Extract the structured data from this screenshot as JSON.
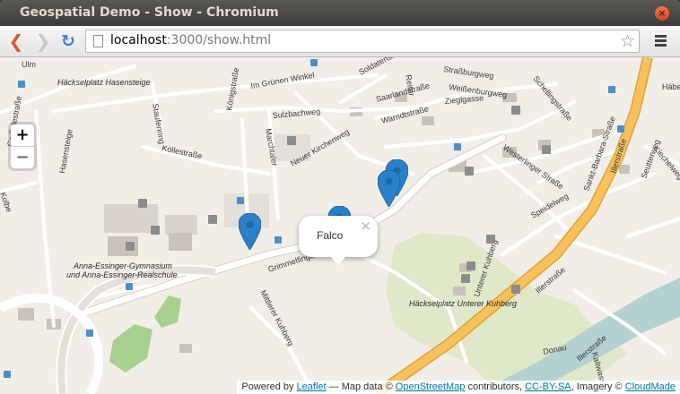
{
  "window": {
    "title": "Geospatial Demo - Show - Chromium",
    "close_glyph": "×"
  },
  "toolbar": {
    "back_glyph": "❮",
    "forward_glyph": "❯",
    "reload_glyph": "↻",
    "url_host": "localhost",
    "url_rest": ":3000/show.html",
    "star_glyph": "☆"
  },
  "map": {
    "zoom_in_label": "+",
    "zoom_out_label": "−",
    "popup": {
      "text": "Falco",
      "close_glyph": "×"
    },
    "marker_color": "#2981ca",
    "labels": {
      "ulm": "Ulm",
      "hasenst": "Häckselplatz Hasensteige",
      "gruenen": "Im Grünen Winkel",
      "koenig": "Königstraße",
      "sulzbach": "Sulzbachweg",
      "neuer": "Neuer Kirchenweg",
      "kolle": "Köllestraße",
      "staufen": "Staufenring",
      "marchtaler": "Marchtaler",
      "soldaten": "Soldatenstraße",
      "strassburg": "Straßburgweg",
      "weissenburg": "Weißenburgweg",
      "zieglgasse": "Zieglgasse",
      "saarland": "Saarlandstraße",
      "warndt": "Warndtstraße",
      "schelling": "Schellingstraße",
      "westerlinger": "Westerlinger Straße",
      "speidel": "Speidelweg",
      "sankt": "Sankt-Barbara-Straße",
      "iller1": "Illerstraße",
      "iller2": "Illerstraße",
      "iller3": "Illerstraße",
      "gymn1": "Anna-Essinger-Gymnasium",
      "gymn2": "und Anna-Essinger-Realschule",
      "grimmel": "Grimmelfinger Weg",
      "mittlerer": "Mittlerer Kuhberg",
      "unterer": "Unterer Kuhberg",
      "hackunt": "Häckselplatz Unterer Kuhberg",
      "donau": "Donau",
      "geissel": "Geißelestraße",
      "hasensteige": "Hasensteige",
      "kiechel": "Kiechelweg",
      "seutter": "Seutterweg",
      "kaltwasser": "Kaltwasser",
      "reiter": "Reiter",
      "haeb": "Häbe",
      "kolle2": "Kolbe"
    }
  },
  "attribution": {
    "prefix": "Powered by",
    "leaflet": "Leaflet",
    "mapdata": " — Map data © ",
    "osm": "OpenStreetMap",
    "contributors": " contributors, ",
    "ccbysa": "CC-BY-SA",
    "imagery": ", Imagery © ",
    "cloudmade": "CloudMade"
  }
}
